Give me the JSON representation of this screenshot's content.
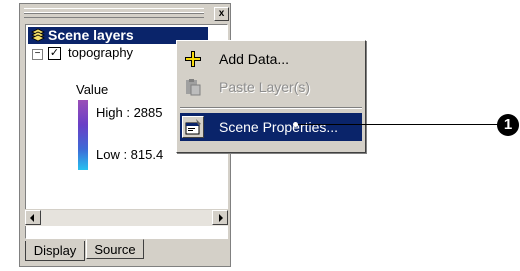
{
  "toc": {
    "close_glyph": "x",
    "root_label": "Scene layers",
    "layer": {
      "expander_glyph": "−",
      "checkbox_glyph": "✓",
      "name": "topography",
      "legend_title": "Value",
      "high_label": "High : 2885",
      "low_label": "Low : 815.4",
      "ramp_colors": [
        "#9a4fb7",
        "#6a3fc6",
        "#3e6ad6",
        "#27c1f0"
      ]
    },
    "tabs": [
      {
        "label": "Display",
        "selected": true
      },
      {
        "label": "Source",
        "selected": false
      }
    ]
  },
  "context_menu": {
    "items": [
      {
        "label": "Add Data...",
        "icon": "add-data-icon",
        "enabled": true
      },
      {
        "label": "Paste Layer(s)",
        "icon": "paste-icon",
        "enabled": false
      },
      {
        "label": "Scene Properties...",
        "icon": "properties-icon",
        "enabled": true,
        "highlighted": true
      }
    ]
  },
  "callout": {
    "number": "1"
  },
  "colors": {
    "selection": "#0a246a",
    "face": "#d4d0c8"
  }
}
